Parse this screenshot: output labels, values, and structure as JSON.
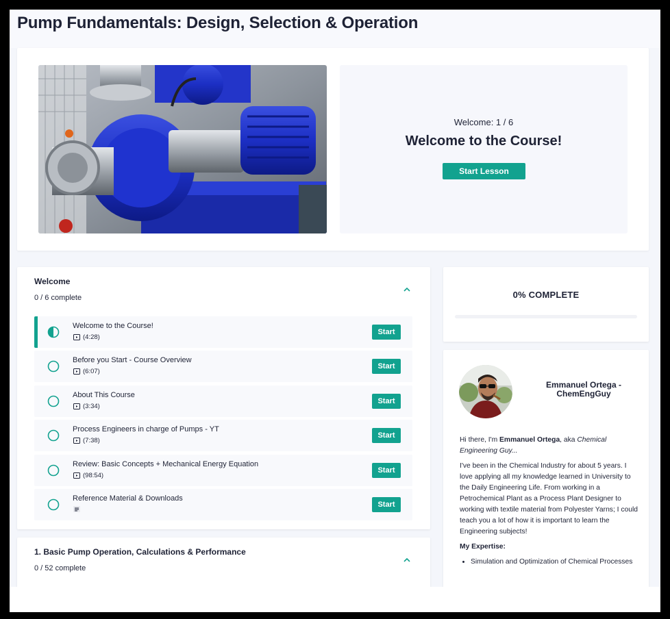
{
  "course": {
    "title": "Pump Fundamentals: Design, Selection & Operation"
  },
  "hero": {
    "image_alt": "Blue centrifugal pumps",
    "welcome_count": "Welcome: 1 / 6",
    "heading": "Welcome to the Course!",
    "start_label": "Start Lesson"
  },
  "sections": [
    {
      "title": "Welcome",
      "count": "0 / 6 complete",
      "lessons": [
        {
          "name": "Welcome to the Course!",
          "duration": "(4:28)",
          "icon": "video-icon",
          "status": "in-progress",
          "start": "Start"
        },
        {
          "name": "Before you Start - Course Overview",
          "duration": "(6:07)",
          "icon": "video-icon",
          "status": "not-started",
          "start": "Start"
        },
        {
          "name": "About This Course",
          "duration": "(3:34)",
          "icon": "video-icon",
          "status": "not-started",
          "start": "Start"
        },
        {
          "name": "Process Engineers in charge of Pumps - YT",
          "duration": "(7:38)",
          "icon": "video-icon",
          "status": "not-started",
          "start": "Start"
        },
        {
          "name": "Review: Basic Concepts + Mechanical Energy Equation",
          "duration": "(98:54)",
          "icon": "video-icon",
          "status": "not-started",
          "start": "Start"
        },
        {
          "name": "Reference Material & Downloads",
          "duration": "",
          "icon": "text-icon",
          "status": "not-started",
          "start": "Start"
        }
      ]
    },
    {
      "title": "1. Basic Pump Operation, Calculations & Performance",
      "count": "0 / 52 complete"
    }
  ],
  "progress": {
    "label": "0% COMPLETE",
    "value": 0
  },
  "author": {
    "name": "Emmanuel Ortega - ChemEngGuy",
    "intro_pre": "Hi there, I'm ",
    "intro_name": "Emmanuel Ortega",
    "intro_mid": ", aka ",
    "intro_alias": "Chemical Engineering Guy...",
    "bio": "I've been in the Chemical Industry for about 5 years. I love applying all my knowledge learned in University to the Daily Engineering Life. From working in a Petrochemical Plant as a Process Plant Designer to working with textile material from Polyester Yarns; I could teach you a lot of how it is important to learn the Engineering subjects!",
    "expertise_title": "My Expertise:",
    "expertise": [
      "Simulation and Optimization of Chemical Processes"
    ]
  },
  "colors": {
    "accent": "#12a28f",
    "text": "#1e2235",
    "panel": "#f6f7fc"
  }
}
